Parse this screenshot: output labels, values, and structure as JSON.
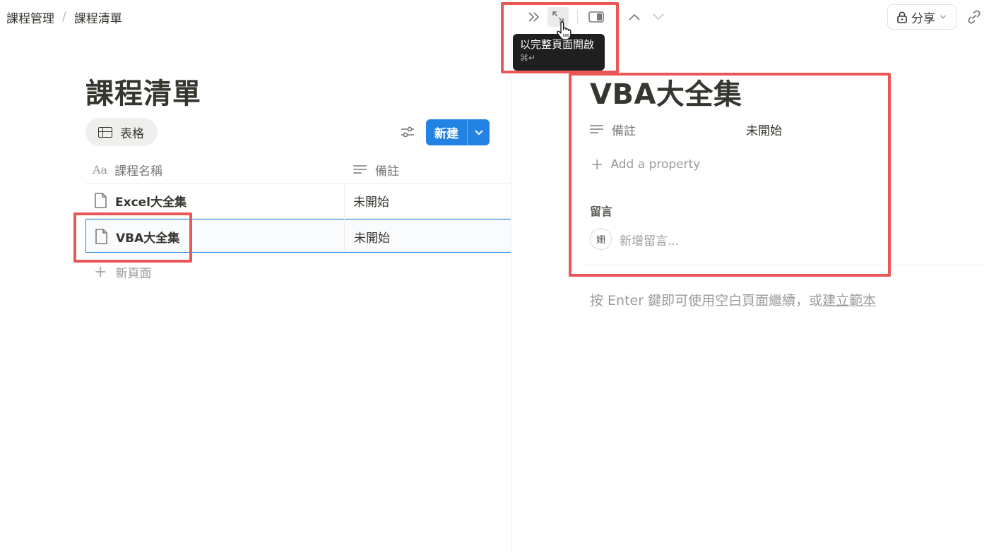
{
  "breadcrumb": {
    "parent": "課程管理",
    "separator": "/",
    "current": "課程清單"
  },
  "database": {
    "title": "課程清單",
    "view_tab": "表格",
    "new_button": "新建",
    "columns": [
      {
        "icon": "Aa",
        "label": "課程名稱"
      },
      {
        "icon": "text-lines-icon",
        "label": "備註"
      }
    ],
    "rows": [
      {
        "name": "Excel大全集",
        "note": "未開始"
      },
      {
        "name": "VBA大全集",
        "note": "未開始"
      }
    ],
    "new_page": "新頁面"
  },
  "peek": {
    "tooltip": {
      "label": "以完整頁面開啟",
      "shortcut": "⌘↵"
    },
    "share_label": "分享",
    "title": "VBA大全集",
    "property": {
      "label": "備註",
      "value": "未開始"
    },
    "add_property": "Add a property",
    "comments_label": "留言",
    "avatar_initial": "姍",
    "comment_placeholder": "新增留言...",
    "empty_hint_prefix": "按 Enter 鍵即可使用空白頁面繼續，或",
    "empty_hint_link": "建立範本"
  },
  "colors": {
    "accent": "#2383e2",
    "highlight": "#eb5757",
    "tooltip_bg": "#1f1f1f"
  }
}
